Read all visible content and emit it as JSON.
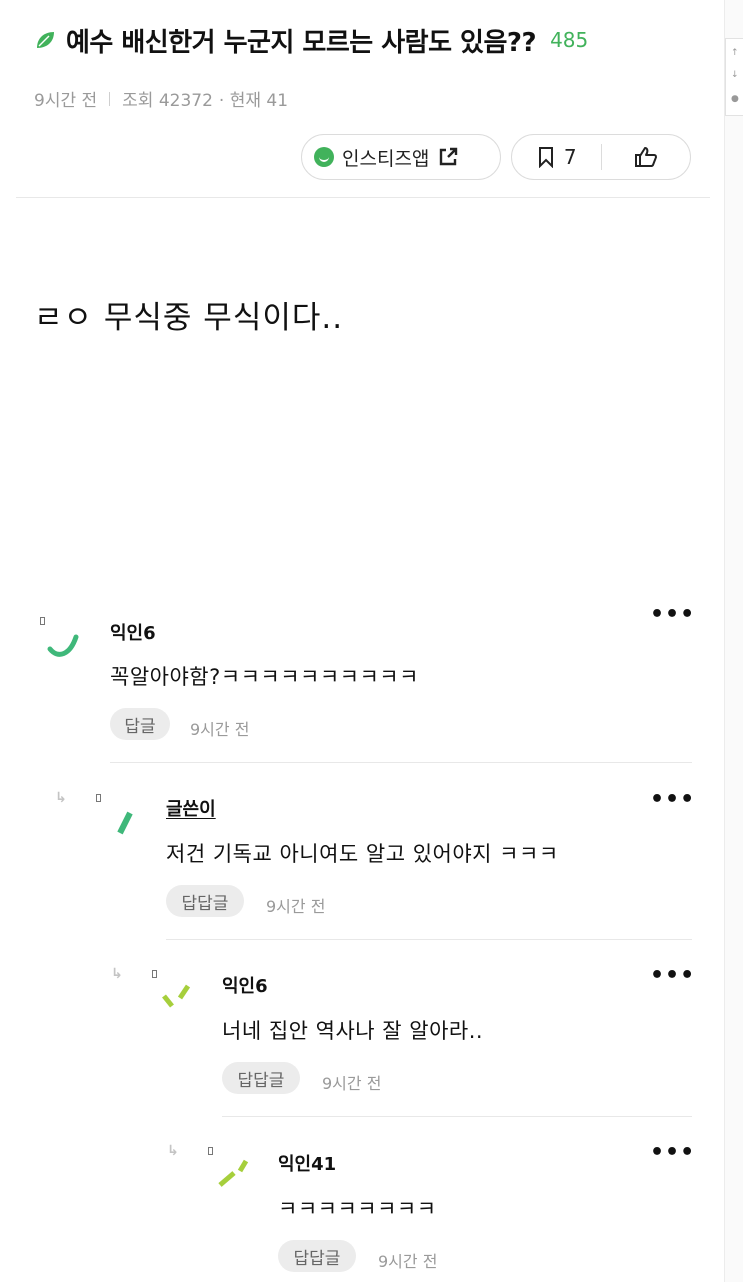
{
  "post": {
    "title": "예수 배신한거 누군지 모르는 사람도 있음??",
    "count": "485",
    "time": "9시간 전",
    "views": "조회 42372",
    "current": "· 현재 41",
    "app_label": "인스티즈앱",
    "bookmark_count": "7",
    "body": "ㄹㅇ 무식중 무식이다.."
  },
  "comments": [
    {
      "author": "익인6",
      "text": "꼭알아야함?ㅋㅋㅋㅋㅋㅋㅋㅋㅋㅋ",
      "reply_label": "답글",
      "time": "9시간 전"
    },
    {
      "author": "글쓴이",
      "text": "저건 기독교 아니여도 알고 있어야지 ㅋㅋㅋ",
      "reply_label": "답답글",
      "time": "9시간 전"
    },
    {
      "author": "익인6",
      "text": "너네 집안 역사나 잘 알아라..",
      "reply_label": "답답글",
      "time": "9시간 전"
    },
    {
      "author": "익인41",
      "text": "ㅋㅋㅋㅋㅋㅋㅋㅋ",
      "reply_label": "답답글",
      "time": "9시간 전"
    }
  ],
  "icons": {
    "leaf": "leaf-icon",
    "app": "smile-icon",
    "external": "external-link-icon",
    "bookmark": "bookmark-icon",
    "like": "thumbs-up-icon",
    "more": "more-dots-icon",
    "reply": "reply-arrow-icon"
  },
  "colors": {
    "accent": "#41b25b",
    "muted": "#9a9a9a",
    "chip_bg": "#ececec"
  }
}
